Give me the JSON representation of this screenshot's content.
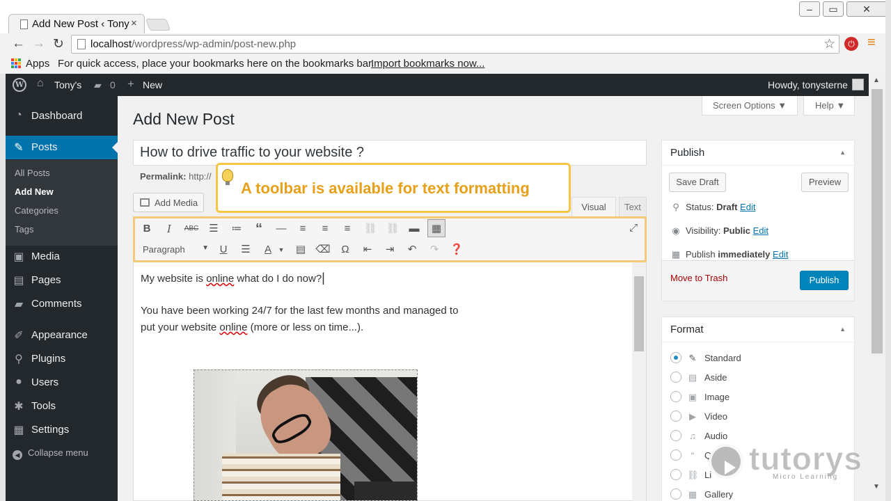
{
  "browser": {
    "tab_title": "Add New Post ‹ Tony",
    "tab_close": "×",
    "url_host": "localhost",
    "url_path": "/wordpress/wp-admin/post-new.php",
    "apps_label": "Apps",
    "bookmarks_message": "For quick access, place your bookmarks here on the bookmarks bar.",
    "import_link": "Import bookmarks now...",
    "win_min": "–",
    "win_max": "▭",
    "win_close": "✕"
  },
  "adminbar": {
    "site_name": "Tony's",
    "comments_count": "0",
    "new_label": "New",
    "howdy": "Howdy, tonysterne"
  },
  "sidebar": {
    "dashboard": "Dashboard",
    "posts": "Posts",
    "submenu": [
      "All Posts",
      "Add New",
      "Categories",
      "Tags"
    ],
    "media": "Media",
    "pages": "Pages",
    "comments": "Comments",
    "appearance": "Appearance",
    "plugins": "Plugins",
    "users": "Users",
    "tools": "Tools",
    "settings": "Settings",
    "collapse": "Collapse menu"
  },
  "main": {
    "screen_options": "Screen Options ▼",
    "help": "Help ▼",
    "page_title": "Add New Post",
    "post_title": "How to drive traffic to your website ?",
    "permalink_label": "Permalink:",
    "permalink_value": "http://",
    "add_media": "Add Media",
    "tab_visual": "Visual",
    "tab_text": "Text",
    "format_select": "Paragraph",
    "content_line1_a": "My website is ",
    "content_line1_b": "online",
    "content_line1_c": " what do I do now?",
    "content_line2": "You have been working 24/7 for the last few months and managed to",
    "content_line3_a": "put your website ",
    "content_line3_b": "online",
    "content_line3_c": " (more or less on time...)."
  },
  "callout": {
    "text": "A toolbar is available for text formatting"
  },
  "publish": {
    "title": "Publish",
    "save_draft": "Save Draft",
    "preview": "Preview",
    "status_label": "Status: ",
    "status_value": "Draft",
    "visibility_label": "Visibility: ",
    "visibility_value": "Public",
    "publish_label": "Publish ",
    "publish_value": "immediately",
    "edit": "Edit",
    "move_to_trash": "Move to Trash",
    "publish_button": "Publish"
  },
  "format": {
    "title": "Format",
    "options": [
      "Standard",
      "Aside",
      "Image",
      "Video",
      "Audio",
      "Q",
      "Li",
      "Gallery"
    ],
    "selected": "Standard"
  },
  "watermark": {
    "brand": "tutorys",
    "tagline": "Micro Learning"
  },
  "colors": {
    "wp_dark": "#23282d",
    "wp_blue": "#0073aa",
    "callout_border": "#f6c542",
    "callout_text": "#e6a019"
  }
}
